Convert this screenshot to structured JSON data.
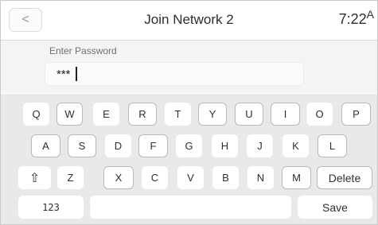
{
  "header": {
    "back_icon": "chevron-left-icon",
    "back_glyph": "<",
    "title": "Join Network 2",
    "time": "7:22",
    "time_suffix": "A"
  },
  "password": {
    "label": "Enter Password",
    "masked_value": "***"
  },
  "keyboard": {
    "row1": [
      "Q",
      "W",
      "E",
      "R",
      "T",
      "Y",
      "U",
      "I",
      "O",
      "P"
    ],
    "row2": [
      "A",
      "S",
      "D",
      "F",
      "G",
      "H",
      "J",
      "K",
      "L"
    ],
    "row3": [
      "Z",
      "X",
      "C",
      "V",
      "B",
      "N",
      "M"
    ],
    "shift_icon": "shift-arrow-icon",
    "shift_glyph": "⇧",
    "delete_label": "Delete",
    "numbers_label": "123",
    "space_label": "",
    "save_label": "Save"
  }
}
